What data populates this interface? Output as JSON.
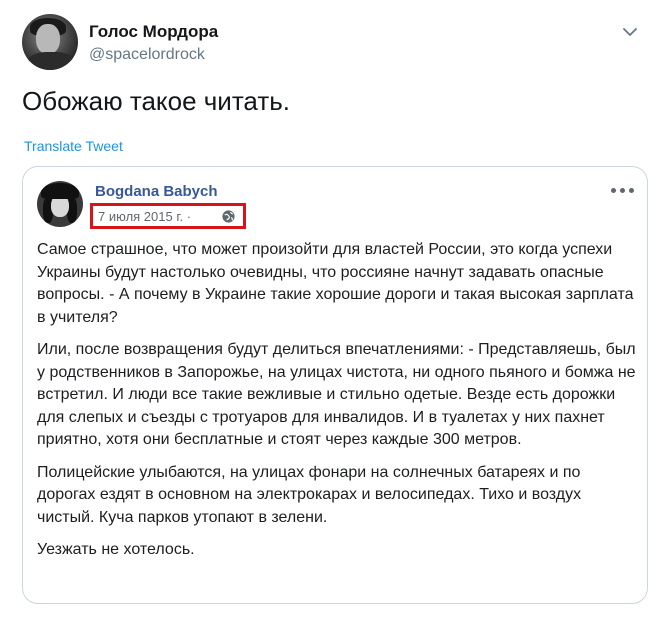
{
  "tweet": {
    "author_name": "Голос Мордора",
    "author_handle": "@spacelordrock",
    "text": "Обожаю такое читать.",
    "translate_label": "Translate Tweet"
  },
  "embedded_post": {
    "author_name": "Bogdana Babych",
    "date": "7 июля 2015 г. ·",
    "highlight_color": "#d7141a",
    "paragraphs": [
      "Самое страшное, что может произойти для властей России, это когда успехи Украины будут настолько очевидны, что россияне начнут задавать опасные вопросы. - А почему в Украине такие хорошие дороги и такая высокая зарплата в учителя?",
      "Или, после возвращения будут делиться впечатлениями: - Представляешь, был у родственников в Запорожье, на улицах чистота, ни одного пьяного и бомжа не встретил. И люди все такие вежливые и стильно одетые. Везде есть дорожки для слепых и съезды с тротуаров для инвалидов. И в туалетах у них пахнет приятно, хотя они бесплатные и стоят через каждые 300 метров.",
      "Полицейские улыбаются, на улицах фонари на солнечных батареях и по дорогах ездят в основном на электрокарах и велосипедах. Тихо и воздух чистый. Куча парков утопают в зелени.",
      "Уезжать не хотелось."
    ]
  },
  "icons": {
    "caret": "chevron-down-icon",
    "globe": "globe-icon",
    "more": "more-options-icon"
  },
  "colors": {
    "link_blue": "#1b95e0",
    "fb_name_blue": "#385898",
    "muted": "#657786"
  }
}
